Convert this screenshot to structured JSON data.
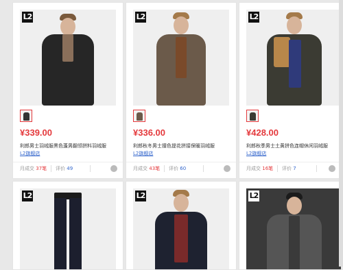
{
  "products": [
    {
      "price": "¥339.00",
      "title": "利郎男士羽绒服黑色蓬男翻领拼料羽绒服",
      "shop": "L2旗舰店",
      "sold_label": "月成交",
      "sold": "37笔",
      "review_label": "评价",
      "reviews": "49"
    },
    {
      "price": "¥336.00",
      "title": "利郎秋冬男士撞色提花拼接保暖羽绒服",
      "shop": "L2旗舰店",
      "sold_label": "月成交",
      "sold": "43笔",
      "review_label": "评价",
      "reviews": "60"
    },
    {
      "price": "¥428.00",
      "title": "利郎秋季男士土黄拼色连帽休闲羽绒服",
      "shop": "L2旗舰店",
      "sold_label": "月成交",
      "sold": "16笔",
      "review_label": "评价",
      "reviews": "7"
    }
  ],
  "brand_logo": "L2",
  "icons": {
    "chat": "chat-bubble-icon"
  }
}
